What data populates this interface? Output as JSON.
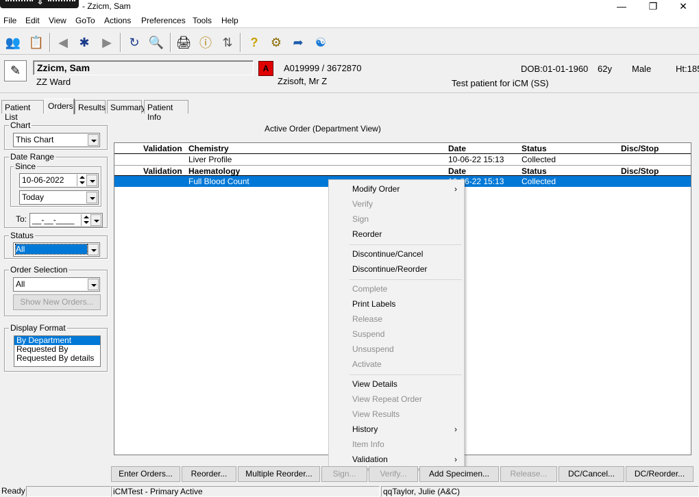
{
  "window": {
    "title": "- Zzicm, Sam"
  },
  "menu": [
    "File",
    "Edit",
    "View",
    "GoTo",
    "Actions",
    "Preferences",
    "Tools",
    "Help"
  ],
  "patient": {
    "name": "Zzicm, Sam",
    "ward": "ZZ Ward",
    "alert": "A",
    "ids": "A019999 / 3672870",
    "doctor": "Zzisoft, Mr Z",
    "dob": "DOB:01-01-1960",
    "age": "62y",
    "sex": "Male",
    "height": "Ht:185",
    "note": "Test patient for iCM (SS)"
  },
  "tabs": [
    "Patient List",
    "Orders",
    "Results",
    "Summary",
    "Patient Info"
  ],
  "left": {
    "chart_label": "Chart",
    "chart_value": "This Chart",
    "date_range_label": "Date Range",
    "since_label": "Since",
    "since_date": "10-06-2022",
    "since_preset": "Today",
    "to_label": "To:",
    "to_date": "__-__-____",
    "status_label": "Status",
    "status_value": "All",
    "order_selection_label": "Order Selection",
    "order_selection_value": "All",
    "show_new_orders": "Show New Orders...",
    "display_format_label": "Display Format",
    "display_formats": [
      "By Department",
      "Requested By",
      "Requested By details"
    ]
  },
  "orders": {
    "title": "Active Order (Department View)",
    "sections": [
      {
        "validation_header": "Validation",
        "department": "Chemistry",
        "date_header": "Date",
        "status_header": "Status",
        "disc_header": "Disc/Stop",
        "rows": [
          {
            "name": "Liver Profile",
            "date": "10-06-22 15:13",
            "status": "Collected"
          }
        ]
      },
      {
        "validation_header": "Validation",
        "department": "Haematology",
        "date_header": "Date",
        "status_header": "Status",
        "disc_header": "Disc/Stop",
        "rows": [
          {
            "name": "Full Blood Count",
            "date": "10-06-22 15:13",
            "status": "Collected"
          }
        ]
      }
    ]
  },
  "context_menu": [
    {
      "label": "Modify Order",
      "enabled": true,
      "submenu": true
    },
    {
      "label": "Verify",
      "enabled": false
    },
    {
      "label": "Sign",
      "enabled": false
    },
    {
      "label": "Reorder",
      "enabled": true
    },
    {
      "label": "Discontinue/Cancel",
      "enabled": true
    },
    {
      "label": "Discontinue/Reorder",
      "enabled": true
    },
    {
      "label": "Complete",
      "enabled": false
    },
    {
      "label": "Print Labels",
      "enabled": true
    },
    {
      "label": "Release",
      "enabled": false
    },
    {
      "label": "Suspend",
      "enabled": false
    },
    {
      "label": "Unsuspend",
      "enabled": false
    },
    {
      "label": "Activate",
      "enabled": false
    },
    {
      "label": "View Details",
      "enabled": true
    },
    {
      "label": "View Repeat Order",
      "enabled": false
    },
    {
      "label": "View Results",
      "enabled": false
    },
    {
      "label": "History",
      "enabled": true,
      "submenu": true
    },
    {
      "label": "Item Info",
      "enabled": false
    },
    {
      "label": "Validation",
      "enabled": true,
      "submenu": true
    }
  ],
  "bottom_buttons": [
    {
      "label": "Enter Orders...",
      "enabled": true
    },
    {
      "label": "Reorder...",
      "enabled": true
    },
    {
      "label": "Multiple Reorder...",
      "enabled": true
    },
    {
      "label": "Sign...",
      "enabled": false
    },
    {
      "label": "Verify...",
      "enabled": false
    },
    {
      "label": "Add Specimen...",
      "enabled": true
    },
    {
      "label": "Release...",
      "enabled": false
    },
    {
      "label": "DC/Cancel...",
      "enabled": true
    },
    {
      "label": "DC/Reorder...",
      "enabled": true
    }
  ],
  "status": {
    "ready": "Ready",
    "environment": "iCMTest - Primary Active",
    "user": "qqTaylor, Julie  (A&C)"
  },
  "colors": {
    "selection": "#0078d7",
    "alert": "#e00000"
  },
  "toolbar_icons": [
    "patient-select-icon",
    "patient-list-icon",
    "back-arrow-icon",
    "people-icon",
    "forward-arrow-icon",
    "refresh-icon",
    "search-icon",
    "printer-icon",
    "info-icon",
    "sort-icon",
    "help-icon",
    "settings-icon",
    "exit-icon",
    "browser-icon"
  ]
}
